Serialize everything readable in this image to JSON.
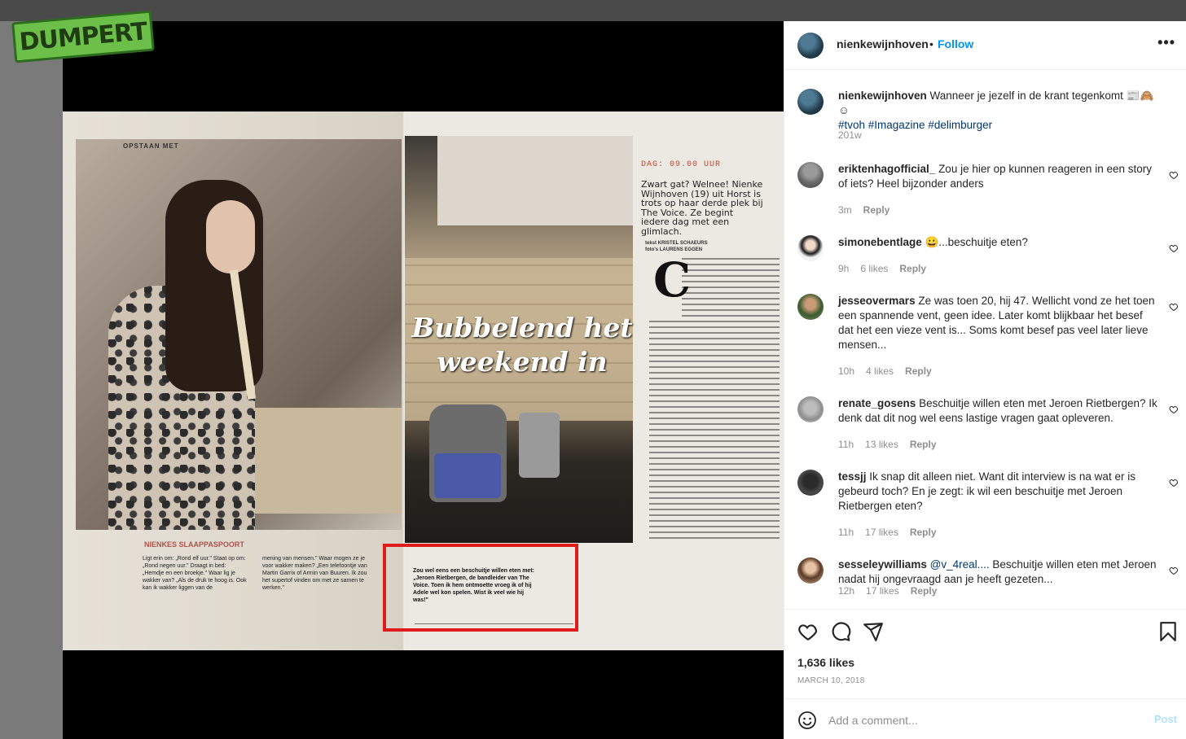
{
  "logo": {
    "text": "DUMPERT"
  },
  "magazine": {
    "section": "OPSTAAN MET",
    "headline_line1": "Bubbelend het",
    "headline_line2": "weekend in",
    "time": "DAG: 09.00 UUR",
    "intro": "Zwart gat? Welnee! Nienke Wijnhoven (19) uit Horst is trots op haar derde plek bij The Voice. Ze begint iedere dag met een glimlach.",
    "credits_1": "tekst KRISTEL SCHAEURS",
    "credits_2": "foto's LAURENS EGGEN",
    "dropcap": "C",
    "sidebar_title": "NIENKES SLAAPPASPOORT",
    "sidebar_col1": "Ligt erin om: „Rond elf uur.\" Staat op om: „Rond negen uur.\" Draagt in bed: „Hemdje en een broekje.\" Waar lig je wakker van? „Als de druk te hoog is. Ook kan ik wakker liggen van de",
    "sidebar_col2": "mening van mensen.\" Waar mogen ze je voor wakker maken? „Een telefoontje van Martin Garrix of Armin van Buuren. Ik zou het supertof vinden om met ze samen te werken.\"",
    "quote": "Zou wel eens een beschuitje willen eten met: „Jeroen Rietbergen, de bandleider van The Voice. Toen ik hem ontmoette vroeg ik of hij Adele wel kon spelen. Wist ik veel wie hij was!\""
  },
  "post": {
    "username": "nienkewijnhoven",
    "follow_label": "Follow",
    "more_label": "•••",
    "caption": "Wanneer je jezelf in de krant tegenkomt 📰🙈☺",
    "hashtags": "#tvoh #Imagazine #delimburger",
    "caption_time": "201w",
    "likes": "1,636 likes",
    "date": "MARCH 10, 2018",
    "comment_placeholder": "Add a comment...",
    "post_label": "Post"
  },
  "comments": [
    {
      "user": "eriktenhagofficial_",
      "text": "Zou je hier op kunnen reageren in een story of iets? Heel bijzonder anders",
      "time": "3m",
      "likes": "",
      "reply": "Reply"
    },
    {
      "user": "simonebentlage",
      "text": "😀...beschuitje eten?",
      "time": "9h",
      "likes": "6 likes",
      "reply": "Reply"
    },
    {
      "user": "jesseovermars",
      "text": "Ze was toen 20, hij 47. Wellicht vond ze het toen een spannende vent, geen idee. Later komt blijkbaar het besef dat het een vieze vent is... Soms komt besef pas veel later lieve mensen...",
      "time": "10h",
      "likes": "4 likes",
      "reply": "Reply"
    },
    {
      "user": "renate_gosens",
      "text": "Beschuitje willen eten met Jeroen Rietbergen? Ik denk dat dit nog wel eens lastige vragen gaat opleveren.",
      "time": "11h",
      "likes": "13 likes",
      "reply": "Reply"
    },
    {
      "user": "tessjj",
      "text": "Ik snap dit alleen niet. Want dit interview is na wat er is gebeurd toch? En je zegt: ik wil een beschuitje met Jeroen Rietbergen eten?",
      "time": "11h",
      "likes": "17 likes",
      "reply": "Reply"
    },
    {
      "user": "sesseleywilliams",
      "mention": "@v_4real....",
      "text": "Beschuitje willen eten met Jeroen nadat hij ongevraagd aan je heeft gezeten...",
      "time": "12h",
      "likes": "17 likes",
      "reply": "Reply"
    }
  ]
}
